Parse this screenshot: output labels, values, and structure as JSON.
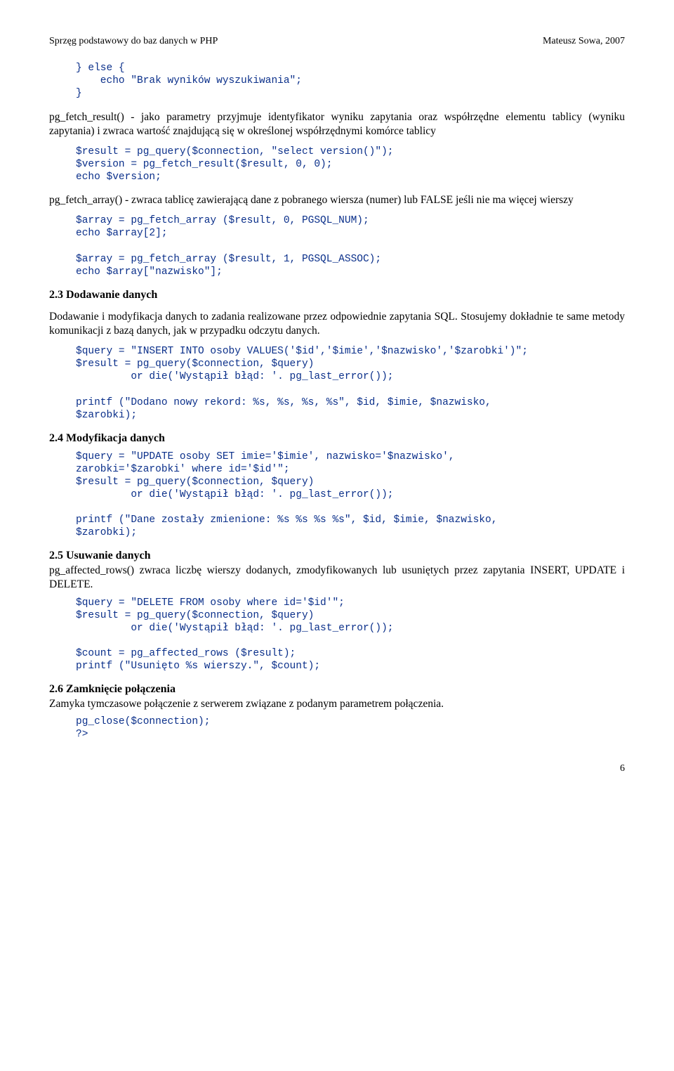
{
  "header": {
    "left": "Sprzęg podstawowy do baz danych w PHP",
    "right": "Mateusz Sowa, 2007"
  },
  "code_block_1": "} else {\n    echo \"Brak wyników wyszukiwania\";\n}",
  "para_1": "pg_fetch_result() - jako parametry przyjmuje identyfikator wyniku zapytania oraz współrzędne elementu tablicy (wyniku zapytania) i zwraca wartość znajdującą się w określonej współrzędnymi komórce tablicy",
  "code_block_2": "$result = pg_query($connection, \"select version()\");\n$version = pg_fetch_result($result, 0, 0);\necho $version;",
  "para_2": "pg_fetch_array() - zwraca tablicę zawierającą dane z pobranego wiersza (numer) lub FALSE jeśli nie ma więcej wierszy",
  "code_block_3": "$array = pg_fetch_array ($result, 0, PGSQL_NUM);\necho $array[2];\n\n$array = pg_fetch_array ($result, 1, PGSQL_ASSOC);\necho $array[\"nazwisko\"];",
  "heading_23": "2.3 Dodawanie danych",
  "para_23": "Dodawanie i modyfikacja danych to zadania realizowane przez odpowiednie zapytania SQL. Stosujemy dokładnie te same metody komunikacji z bazą danych, jak w przypadku odczytu danych.",
  "code_block_4": "$query = \"INSERT INTO osoby VALUES('$id','$imie','$nazwisko','$zarobki')\";\n$result = pg_query($connection, $query)\n         or die('Wystąpił błąd: '. pg_last_error());\n\nprintf (\"Dodano nowy rekord: %s, %s, %s, %s\", $id, $imie, $nazwisko,\n$zarobki);",
  "heading_24": "2.4 Modyfikacja danych",
  "code_block_5": "$query = \"UPDATE osoby SET imie='$imie', nazwisko='$nazwisko',\nzarobki='$zarobki' where id='$id'\";\n$result = pg_query($connection, $query)\n         or die('Wystąpił błąd: '. pg_last_error());\n\nprintf (\"Dane zostały zmienione: %s %s %s %s\", $id, $imie, $nazwisko,\n$zarobki);",
  "heading_25": "2.5 Usuwanie danych",
  "para_25": "pg_affected_rows() zwraca liczbę wierszy dodanych, zmodyfikowanych lub usuniętych przez zapytania INSERT, UPDATE i DELETE.",
  "code_block_6": "$query = \"DELETE FROM osoby where id='$id'\";\n$result = pg_query($connection, $query)\n         or die('Wystąpił błąd: '. pg_last_error());\n\n$count = pg_affected_rows ($result);\nprintf (\"Usunięto %s wierszy.\", $count);",
  "heading_26": "2.6 Zamknięcie połączenia",
  "para_26": "Zamyka tymczasowe połączenie z serwerem związane z podanym parametrem połączenia.",
  "code_block_7": "pg_close($connection);\n?>",
  "page_number": "6"
}
